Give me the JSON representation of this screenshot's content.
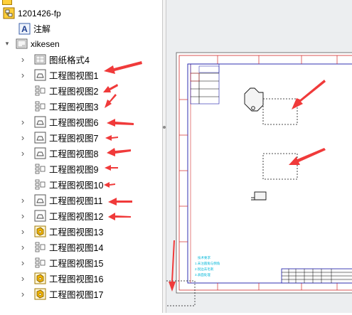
{
  "tree": {
    "root": {
      "label": "1201426-fp",
      "icon": "drawing-root-icon"
    },
    "annotations": {
      "label": "注解",
      "icon": "annotation-icon"
    },
    "sheet": {
      "label": "xikesen",
      "icon": "sheet-icon",
      "expanded": true
    },
    "items": [
      {
        "label": "图纸格式4",
        "icon": "sheet-format-icon",
        "expandable": true
      },
      {
        "label": "工程图视图1",
        "icon": "drawing-view-icon",
        "expandable": true
      },
      {
        "label": "工程图视图2",
        "icon": "empty-view-icon",
        "expandable": false
      },
      {
        "label": "工程图视图3",
        "icon": "empty-view-icon",
        "expandable": false
      },
      {
        "label": "工程图视图6",
        "icon": "drawing-view-icon",
        "expandable": true
      },
      {
        "label": "工程图视图7",
        "icon": "drawing-view-icon",
        "expandable": true
      },
      {
        "label": "工程图视图8",
        "icon": "drawing-view-icon",
        "expandable": true
      },
      {
        "label": "工程图视图9",
        "icon": "empty-view-icon",
        "expandable": false
      },
      {
        "label": "工程图视图10",
        "icon": "empty-view-icon",
        "expandable": false
      },
      {
        "label": "工程图视图11",
        "icon": "drawing-view-icon",
        "expandable": true
      },
      {
        "label": "工程图视图12",
        "icon": "drawing-view-icon",
        "expandable": true
      },
      {
        "label": "工程图视图13",
        "icon": "part-view-icon",
        "expandable": true
      },
      {
        "label": "工程图视图14",
        "icon": "empty-view-icon",
        "expandable": true
      },
      {
        "label": "工程图视图15",
        "icon": "empty-view-icon",
        "expandable": true
      },
      {
        "label": "工程图视图16",
        "icon": "part-view-icon",
        "expandable": true
      },
      {
        "label": "工程图视图17",
        "icon": "part-view-icon",
        "expandable": true
      }
    ]
  },
  "colors": {
    "arrow": "#f03a3a",
    "border_red": "#d22a2a",
    "frame_blue": "#1a1aa8",
    "note_cyan": "#00b7d9",
    "icon_gold": "#f0b400"
  }
}
